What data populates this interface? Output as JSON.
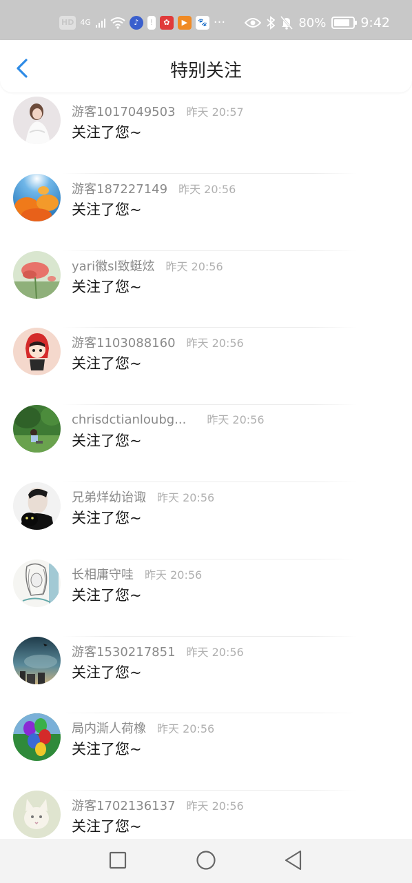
{
  "status_bar": {
    "hd_label": "HD",
    "net_label": "4G",
    "battery": "80%",
    "battery_level": 0.8,
    "time": "9:42",
    "overflow": "···"
  },
  "header": {
    "title": "特别关注"
  },
  "follow_list": [
    {
      "name": "游客1017049503",
      "time": "昨天 20:57",
      "message": "关注了您~",
      "avatar": "avatar-woman-white-dress"
    },
    {
      "name": "游客187227149",
      "time": "昨天 20:56",
      "message": "关注了您~",
      "avatar": "avatar-orange-flowers"
    },
    {
      "name": "yari徽sl致蜓炫",
      "time": "昨天 20:56",
      "message": "关注了您~",
      "avatar": "avatar-red-poppy"
    },
    {
      "name": "游客1103088160",
      "time": "昨天 20:56",
      "message": "关注了您~",
      "avatar": "avatar-cartoon-girl"
    },
    {
      "name": "chrisdctianloubg...",
      "time": "昨天 20:56",
      "message": "关注了您~",
      "avatar": "avatar-park-kid"
    },
    {
      "name": "兄弟烊幼诒诹",
      "time": "昨天 20:56",
      "message": "关注了您~",
      "avatar": "avatar-man-black-cat"
    },
    {
      "name": "长相庸守哇",
      "time": "昨天 20:56",
      "message": "关注了您~",
      "avatar": "avatar-sketch-girl"
    },
    {
      "name": "游客1530217851",
      "time": "昨天 20:56",
      "message": "关注了您~",
      "avatar": "avatar-sky-city"
    },
    {
      "name": "局内澌人荷橡",
      "time": "昨天 20:56",
      "message": "关注了您~",
      "avatar": "avatar-balloons"
    },
    {
      "name": "游客1702136137",
      "time": "昨天 20:56",
      "message": "关注了您~",
      "avatar": "avatar-white-cat"
    }
  ],
  "nav_bar": {
    "recent_icon": "square-icon",
    "home_icon": "circle-icon",
    "back_icon": "triangle-back-icon"
  },
  "colors": {
    "accent_blue": "#2e8be6",
    "status_bar_bg": "#c8c8c8",
    "name_gray": "#8a8a8a",
    "time_gray": "#b0b0b0"
  }
}
